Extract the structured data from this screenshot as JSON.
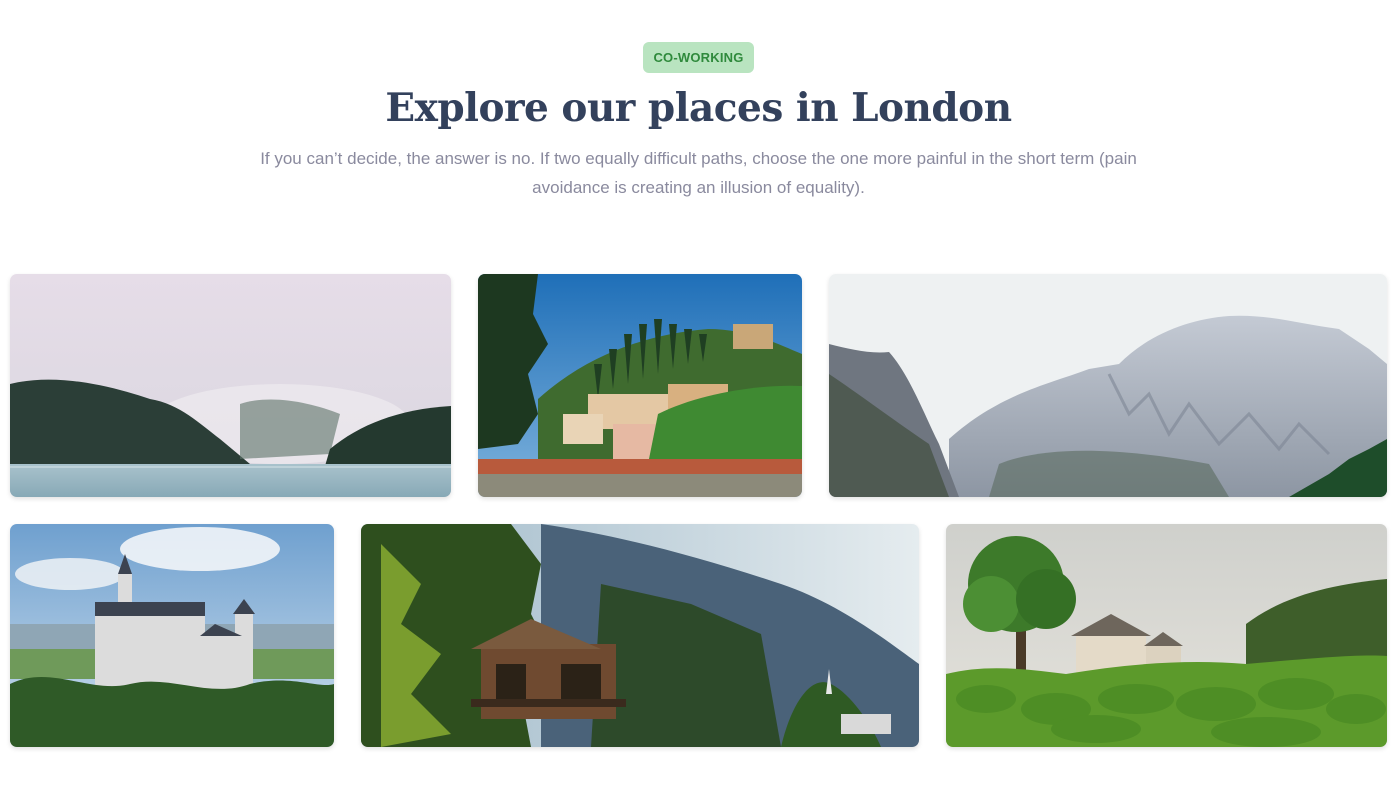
{
  "header": {
    "badge": "CO-WORKING",
    "title": "Explore our places in London",
    "subtitle": "If you can’t decide, the answer is no. If two equally difficult paths, choose the one more painful in the short term (pain avoidance is creating an illusion of equality)."
  },
  "gallery": {
    "items": [
      {
        "name": "foggy-lake",
        "icon": "photo-misty-lake"
      },
      {
        "name": "hillside-town",
        "icon": "photo-italian-town"
      },
      {
        "name": "mountains",
        "icon": "photo-rocky-mountains"
      },
      {
        "name": "castle",
        "icon": "photo-castle"
      },
      {
        "name": "forest-cabin",
        "icon": "photo-wooden-cabin"
      },
      {
        "name": "topiary-garden",
        "icon": "photo-manor-garden"
      }
    ]
  }
}
